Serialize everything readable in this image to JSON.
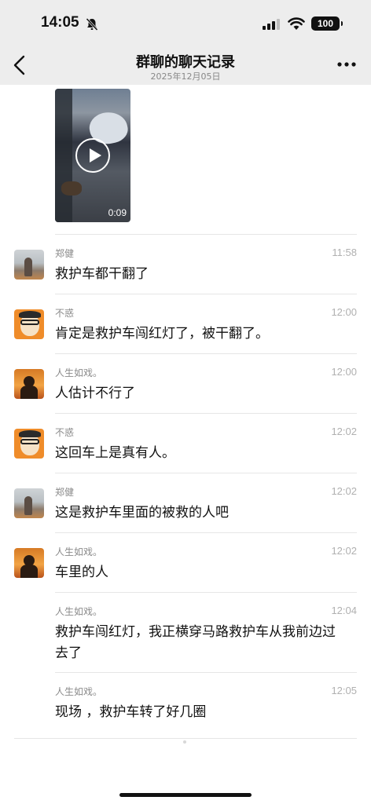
{
  "status_bar": {
    "time": "14:05",
    "battery": "100"
  },
  "nav": {
    "title": "群聊的聊天记录",
    "subtitle": "2025年12月05日"
  },
  "video": {
    "duration": "0:09"
  },
  "messages": [
    {
      "sender": "郑健",
      "time": "11:58",
      "text": "救护车都干翻了",
      "avatar": "zhengjian-avatar"
    },
    {
      "sender": "不惑",
      "time": "12:00",
      "text": "肯定是救护车闯红灯了，被干翻了。",
      "avatar": "buhuo-avatar"
    },
    {
      "sender": "人生如戏。",
      "time": "12:00",
      "text": "人估计不行了",
      "avatar": "renshengruxi-avatar"
    },
    {
      "sender": "不惑",
      "time": "12:02",
      "text": "这回车上是真有人。",
      "avatar": "buhuo-avatar"
    },
    {
      "sender": "郑健",
      "time": "12:02",
      "text": "这是救护车里面的被救的人吧",
      "avatar": "zhengjian-avatar"
    },
    {
      "sender": "人生如戏。",
      "time": "12:02",
      "text": "车里的人",
      "avatar": "renshengruxi-avatar"
    },
    {
      "sender": "人生如戏。",
      "time": "12:04",
      "text": "救护车闯红灯，我正横穿马路救护车从我前边过去了",
      "avatar": ""
    },
    {
      "sender": "人生如戏。",
      "time": "12:05",
      "text": "现场 ，救护车转了好几圈",
      "avatar": ""
    }
  ],
  "colors": {
    "header_bg": "#ededed",
    "sender_gray": "#8a8a8a",
    "time_gray": "#b0b0b0"
  }
}
